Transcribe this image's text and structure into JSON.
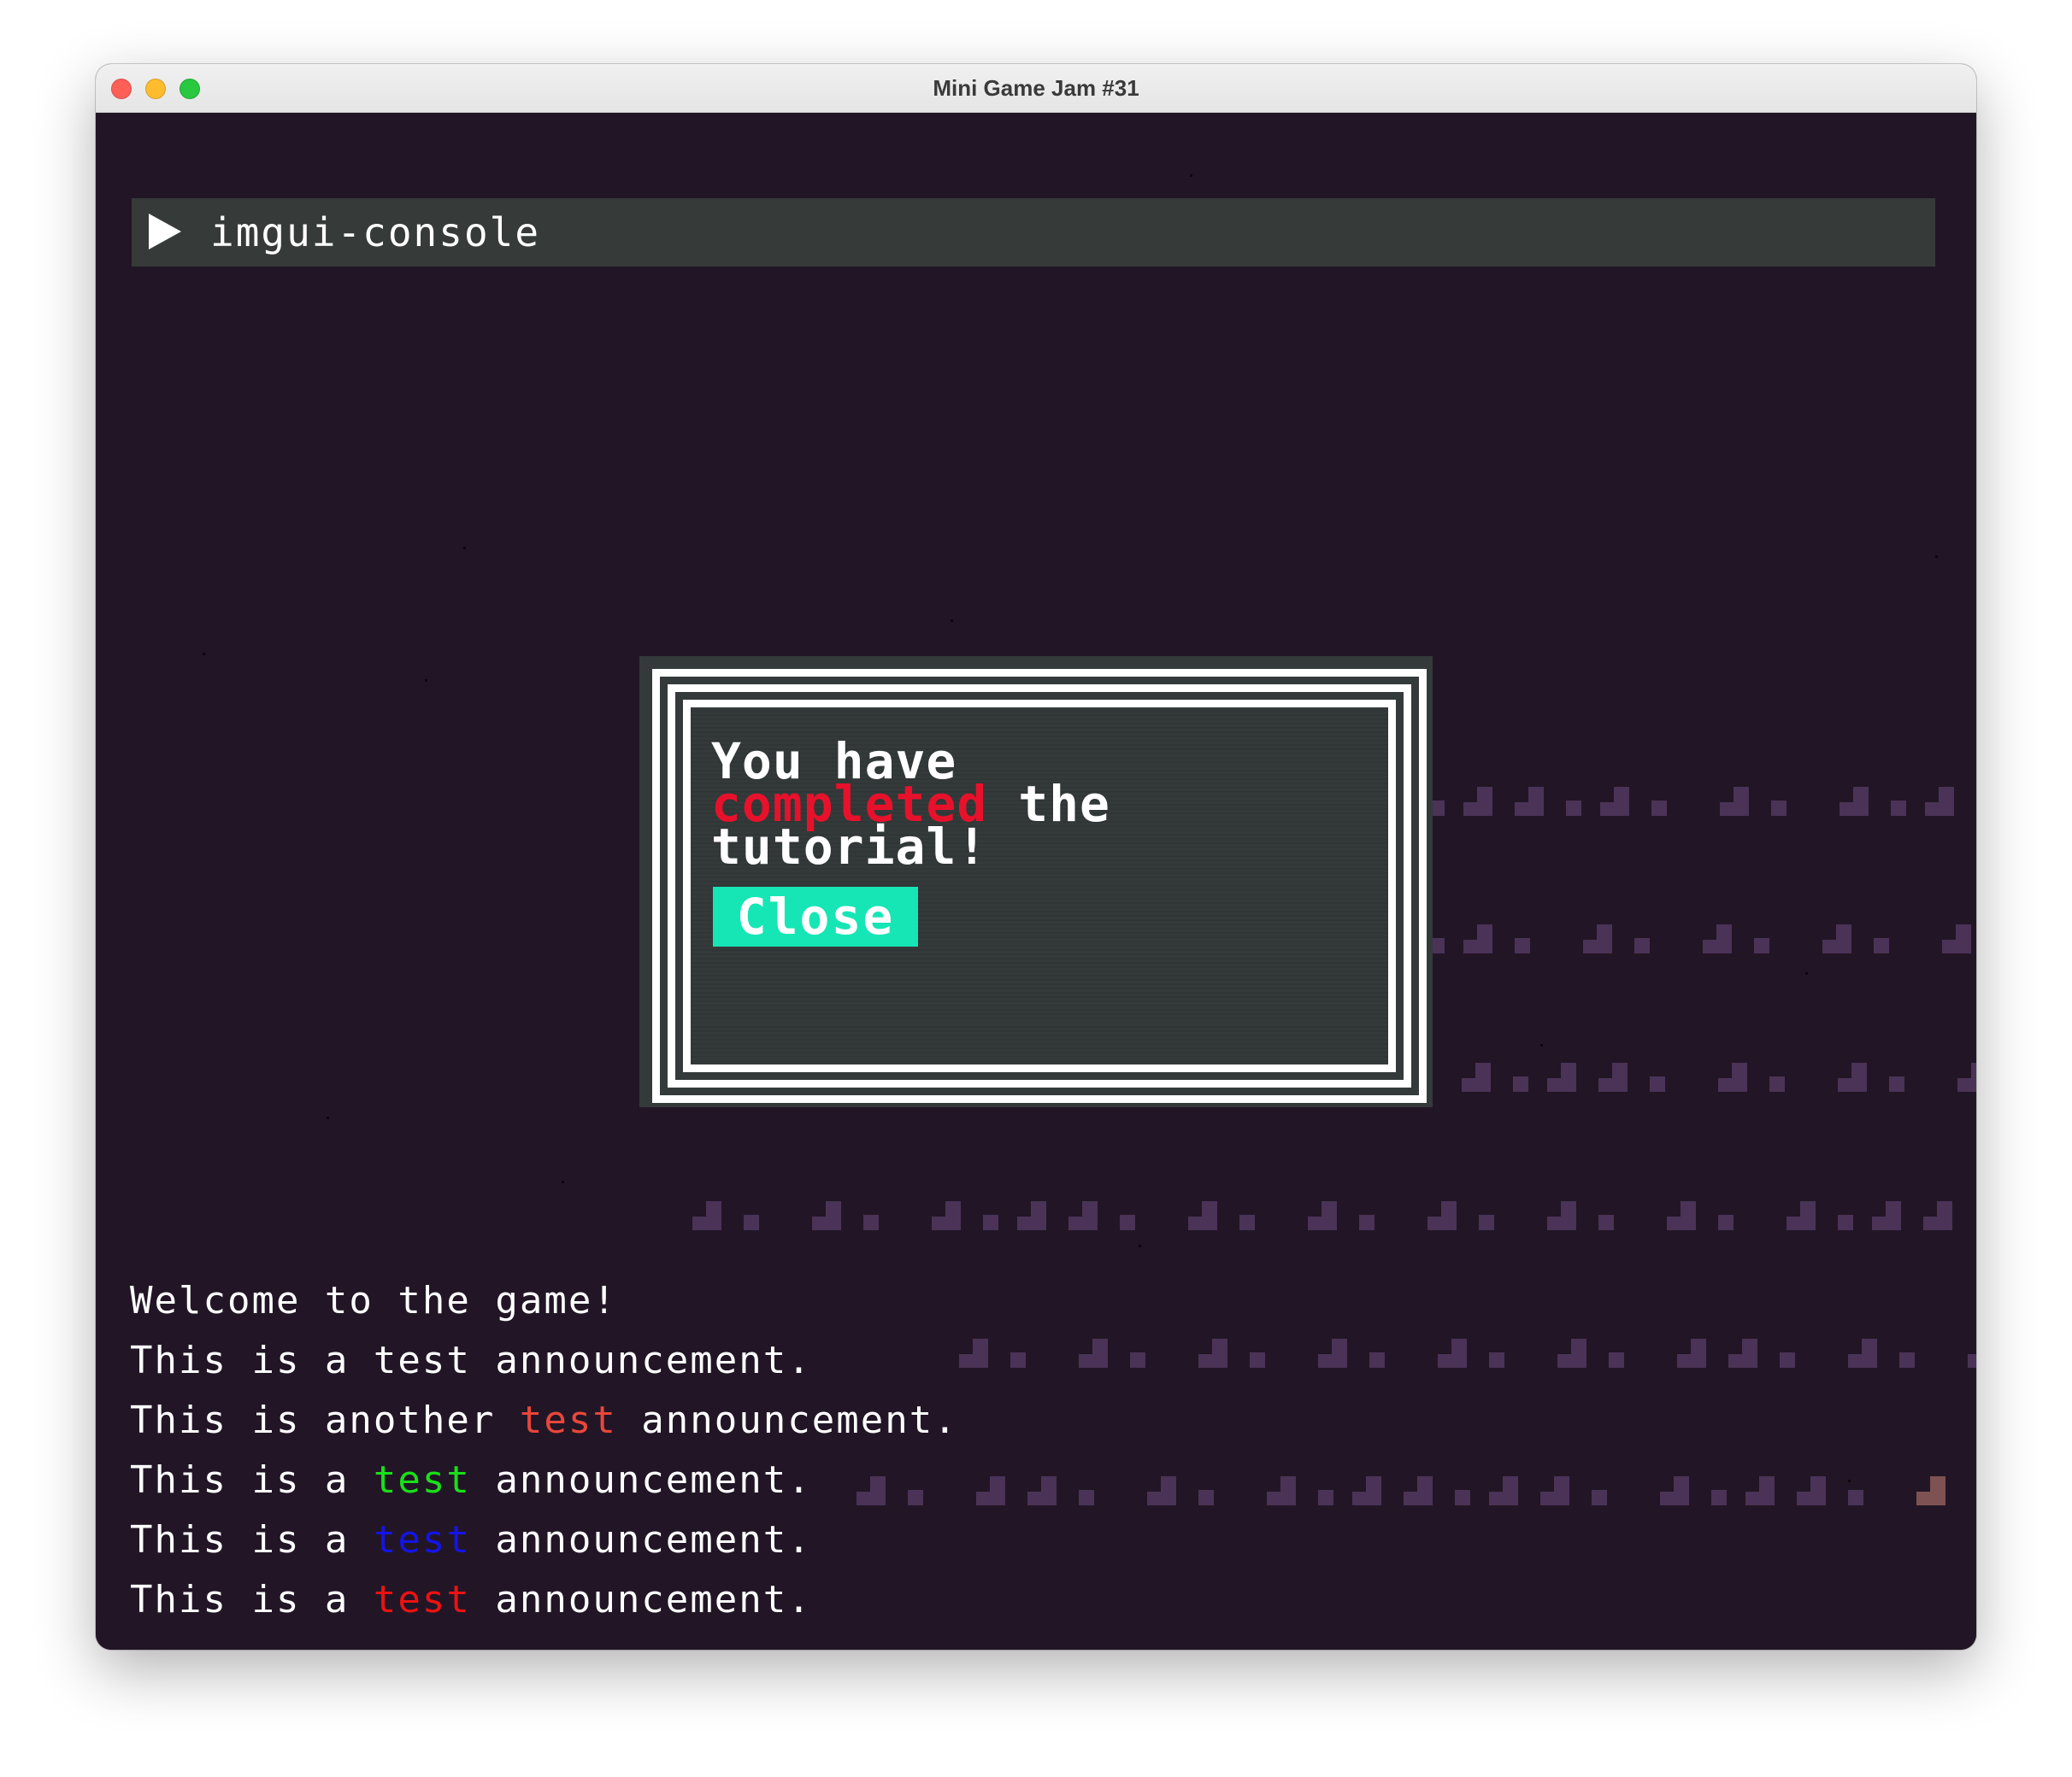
{
  "window": {
    "title": "Mini Game Jam #31",
    "controls": {
      "close_color": "#fe5f57",
      "minimize_color": "#febc2e",
      "maximize_color": "#28c840"
    }
  },
  "console": {
    "title": "imgui-console",
    "expand_icon": "triangle-right-icon"
  },
  "dialog": {
    "line1": "You have",
    "line2_highlight": "completed",
    "line2_rest": " the",
    "line3": "tutorial!",
    "highlight_color": "#e8112b",
    "close_button": "Close",
    "close_button_color": "#16e6b5"
  },
  "announcements": [
    {
      "before": "Welcome to the game!",
      "highlight": "",
      "after": "",
      "color": "#ffffff"
    },
    {
      "before": "This is a test announcement.",
      "highlight": "",
      "after": "",
      "color": "#ffffff"
    },
    {
      "before": "This is another ",
      "highlight": "test",
      "after": " announcement.",
      "color": "#e8473a"
    },
    {
      "before": "This is a ",
      "highlight": "test",
      "after": " announcement.",
      "color": "#19e019"
    },
    {
      "before": "This is a ",
      "highlight": "test",
      "after": " announcement.",
      "color": "#1414e6"
    },
    {
      "before": "This is a ",
      "highlight": "test",
      "after": " announcement.",
      "color": "#ec1212"
    }
  ],
  "colors": {
    "background": "#221626",
    "tile_purple": "#4a3356",
    "tile_brown": "#7e5252"
  }
}
